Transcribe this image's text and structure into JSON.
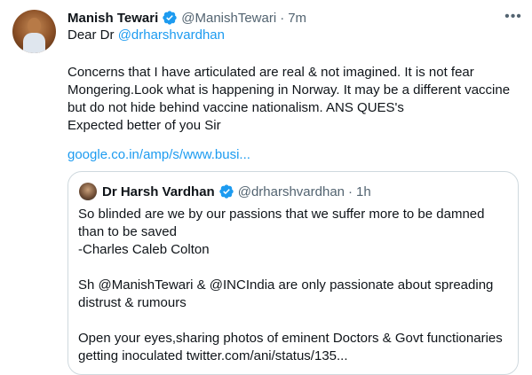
{
  "tweet": {
    "author_name": "Manish Tewari",
    "author_handle": "@ManishTewari",
    "separator": "·",
    "time": "7m",
    "more_icon": "more-dots-icon",
    "greeting": "Dear Dr ",
    "greeting_mention": "@drharshvardhan",
    "body_lines": [
      "Concerns that I have articulated are real & not imagined. It is not fear",
      "Mongering.Look what is happening in Norway. It may be a different vaccine",
      "but do not hide behind vaccine nationalism. ANS QUES's",
      "Expected better of you Sir"
    ],
    "link": "google.co.in/amp/s/www.busi..."
  },
  "quoted": {
    "author_name": "Dr Harsh Vardhan",
    "author_handle": "@drharshvardhan",
    "separator": "·",
    "time": "1h",
    "lines": [
      "So blinded are we by our passions that we suffer more to be damned",
      "than to be saved",
      "-Charles Caleb Colton",
      "",
      "Sh @ManishTewari & @INCIndia are only passionate about spreading",
      "distrust & rumours",
      "",
      "Open your eyes,sharing photos of eminent Doctors & Govt functionaries",
      "getting inoculated  twitter.com/ani/status/135..."
    ]
  },
  "colors": {
    "text": "#0f1419",
    "muted": "#536471",
    "accent": "#1d9bf0",
    "border": "#cfd9de"
  }
}
